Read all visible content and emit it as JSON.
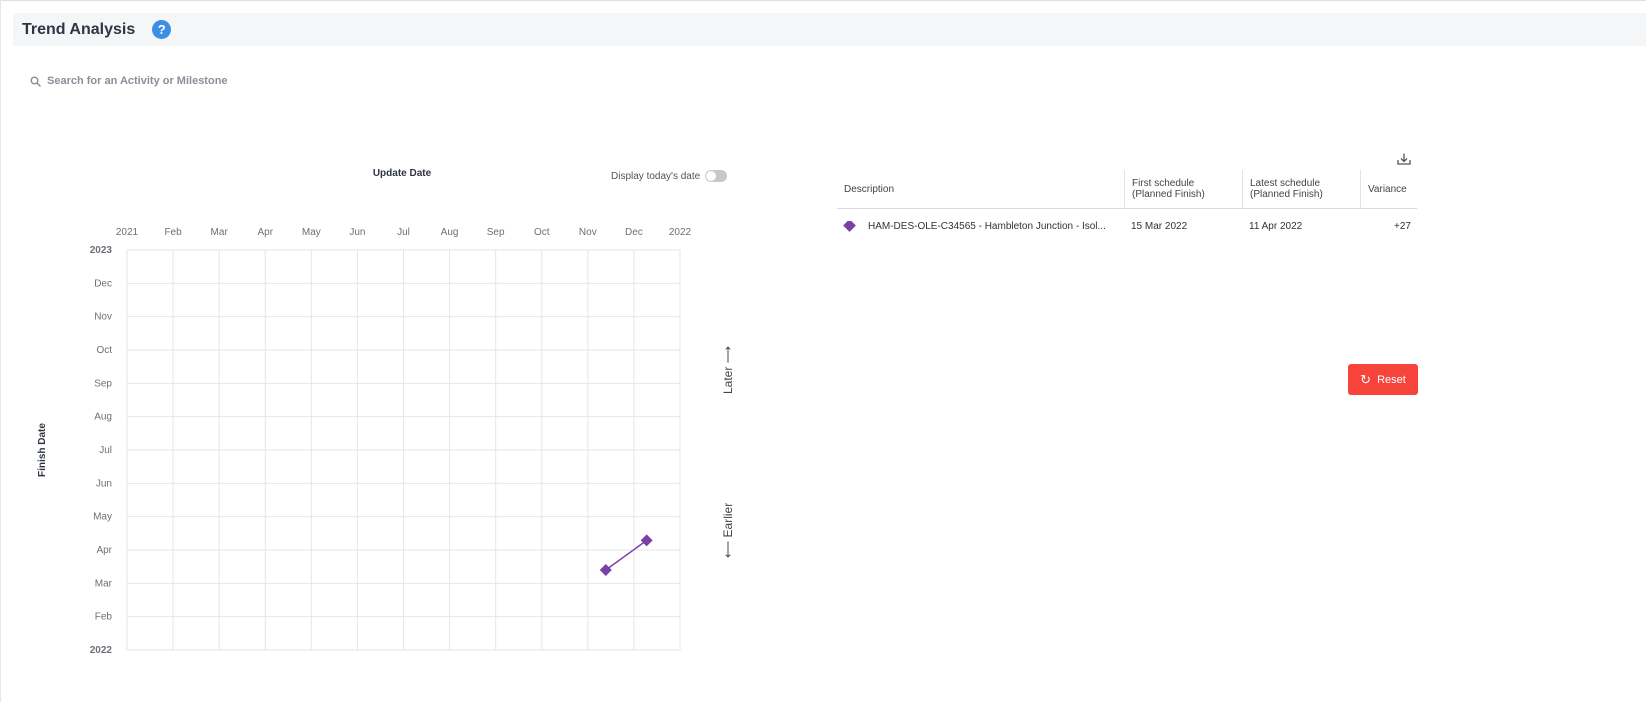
{
  "page": {
    "title": "Trend Analysis",
    "help_glyph": "?"
  },
  "search": {
    "placeholder": "Search for an Activity or Milestone",
    "icon": "search-icon"
  },
  "chart_controls": {
    "display_today_label": "Display today's date",
    "display_today_enabled": false,
    "later_label": "Later",
    "earlier_label": "Earlier"
  },
  "chart_data": {
    "type": "line",
    "title": "",
    "xlabel": "Update Date",
    "ylabel": "Finish Date",
    "x_tick_labels": [
      "2021",
      "Feb",
      "Mar",
      "Apr",
      "May",
      "Jun",
      "Jul",
      "Aug",
      "Sep",
      "Oct",
      "Nov",
      "Dec",
      "2022"
    ],
    "y_tick_labels": [
      "2023",
      "Dec",
      "Nov",
      "Oct",
      "Sep",
      "Aug",
      "Jul",
      "Jun",
      "May",
      "Apr",
      "Mar",
      "Feb",
      "2022"
    ],
    "xlim": [
      "2021-01-01",
      "2022-01-01"
    ],
    "ylim": [
      "2022-01-01",
      "2023-01-01"
    ],
    "grid": true,
    "series": [
      {
        "marker": "diamond",
        "color": "#7c3fa6",
        "points": [
          {
            "x": "2021-11-13",
            "y": "2022-03-15"
          },
          {
            "x": "2021-12-10",
            "y": "2022-04-11"
          }
        ]
      }
    ]
  },
  "table": {
    "columns": [
      {
        "line1": "Description",
        "line2": ""
      },
      {
        "line1": "First schedule",
        "line2": "(Planned Finish)"
      },
      {
        "line1": "Latest schedule",
        "line2": "(Planned Finish)"
      },
      {
        "line1": "Variance",
        "line2": ""
      }
    ],
    "rows": [
      {
        "description": "HAM-DES-OLE-C34565 - Hambleton Junction - Isol...",
        "first": "15 Mar 2022",
        "latest": "11 Apr 2022",
        "variance": "+27",
        "color": "#7c3fa6"
      }
    ]
  },
  "actions": {
    "reset_label": "Reset",
    "download_icon": "download-icon"
  },
  "colors": {
    "accent": "#3d8fe6",
    "series": "#7c3fa6",
    "reset": "#f7443b"
  }
}
